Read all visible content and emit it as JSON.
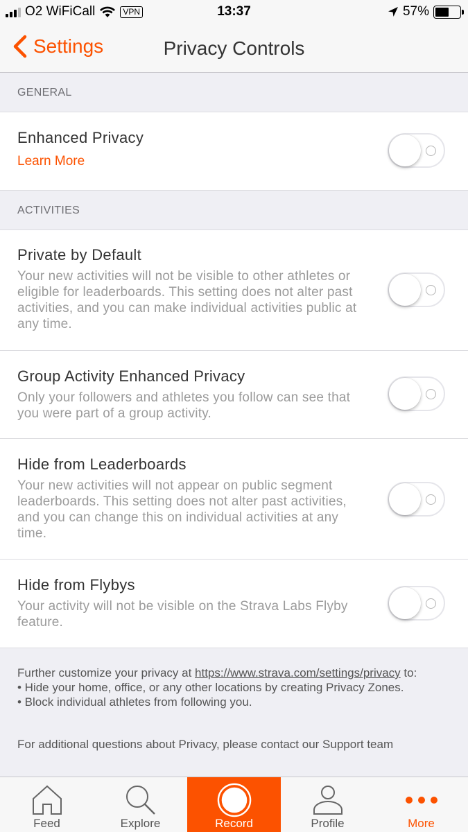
{
  "status_bar": {
    "carrier": "O2 WiFiCall",
    "vpn": "VPN",
    "time": "13:37",
    "battery": "57%",
    "battery_fraction": 0.57
  },
  "nav": {
    "back_label": "Settings",
    "title": "Privacy Controls"
  },
  "colors": {
    "accent": "#fc5200"
  },
  "sections": {
    "general": {
      "header": "GENERAL",
      "enhanced_privacy": {
        "title": "Enhanced Privacy",
        "link": "Learn More",
        "enabled": false
      }
    },
    "activities": {
      "header": "ACTIVITIES",
      "items": [
        {
          "title": "Private by Default",
          "description": "Your new activities will not be visible to other athletes or eligible for leaderboards. This setting does not alter past activities, and you can make individual activities public at any time.",
          "enabled": false
        },
        {
          "title": "Group Activity Enhanced Privacy",
          "description": "Only your followers and athletes you follow can see that you were part of a group activity.",
          "enabled": false
        },
        {
          "title": "Hide from Leaderboards",
          "description": "Your new activities will not appear on public segment leaderboards. This setting does not alter past activities, and you can change this on individual activities at any time.",
          "enabled": false
        },
        {
          "title": "Hide from Flybys",
          "description": "Your activity will not be visible on the Strava Labs Flyby feature.",
          "enabled": false
        }
      ]
    }
  },
  "footer": {
    "intro": "Further customize your privacy at ",
    "url": "https://www.strava.com/settings/privacy",
    "intro_suffix": " to:",
    "bullets": [
      "• Hide your home, office, or any other locations by creating Privacy Zones.",
      "• Block individual athletes from following you."
    ],
    "para2": "For additional questions about Privacy, please contact our Support team"
  },
  "tab_bar": {
    "tabs": [
      {
        "label": "Feed",
        "icon": "home-icon"
      },
      {
        "label": "Explore",
        "icon": "search-icon"
      },
      {
        "label": "Record",
        "icon": "record-icon",
        "active": true
      },
      {
        "label": "Profile",
        "icon": "profile-icon"
      },
      {
        "label": "More",
        "icon": "more-dots-icon"
      }
    ]
  }
}
